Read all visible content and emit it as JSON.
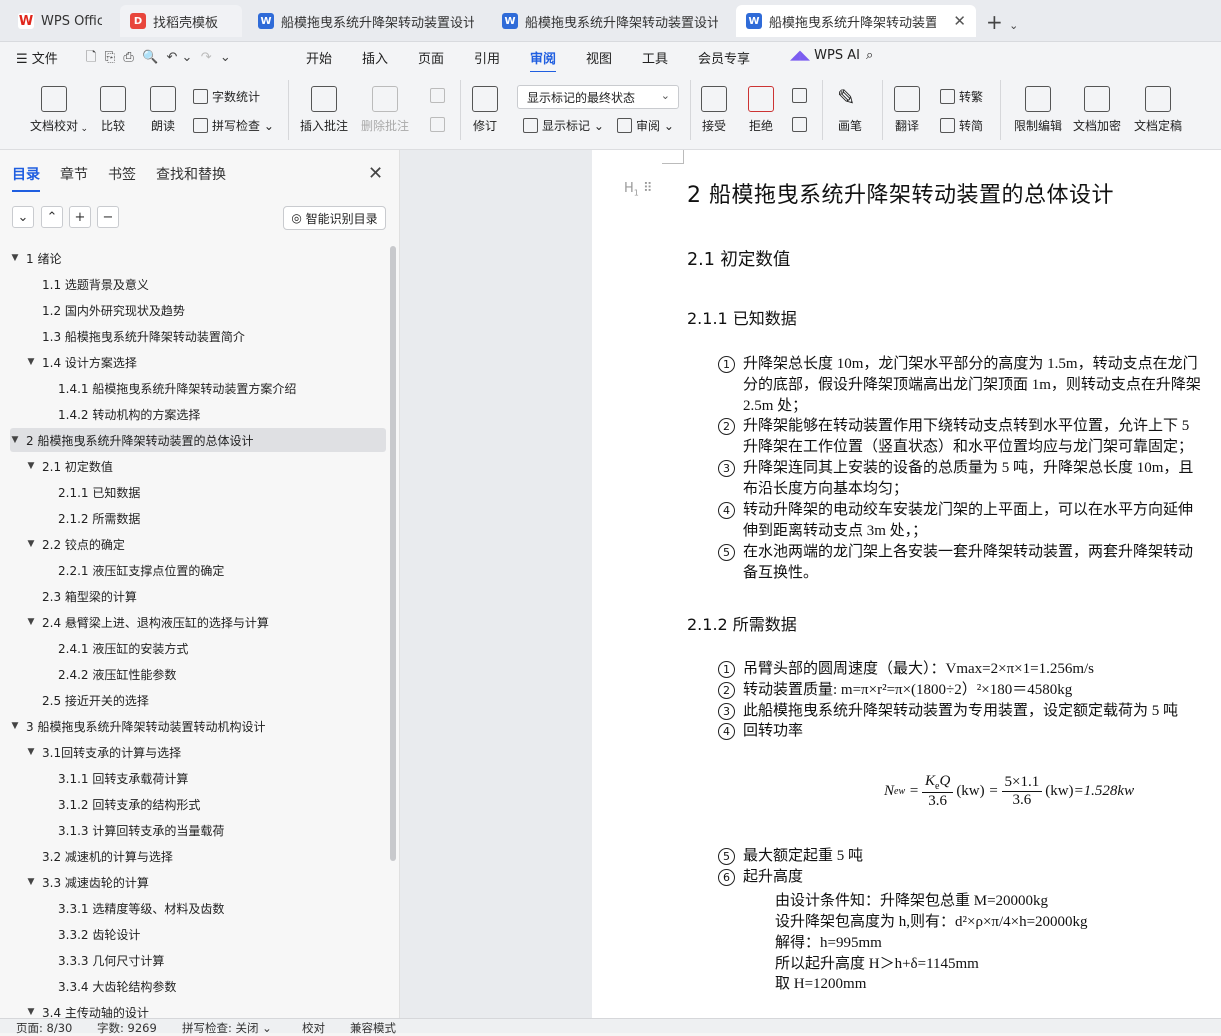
{
  "tabs": [
    {
      "label": "WPS Office",
      "icon": "wps-logo-icon"
    },
    {
      "label": "找稻壳模板",
      "icon": "docer-icon"
    },
    {
      "label": "船模拖曳系统升降架转动装置设计 任",
      "icon": "word-doc-icon"
    },
    {
      "label": "船模拖曳系统升降架转动装置设计 开",
      "icon": "word-doc-icon"
    },
    {
      "label": "船模拖曳系统升降架转动装置",
      "icon": "word-doc-icon"
    }
  ],
  "menu": {
    "file": "文件",
    "items": [
      "开始",
      "插入",
      "页面",
      "引用",
      "审阅",
      "视图",
      "工具",
      "会员专享"
    ],
    "active": "审阅",
    "wps_ai": "WPS AI"
  },
  "ribbon": {
    "doc_check": "文档校对",
    "compare": "比较",
    "read_aloud": "朗读",
    "word_count": "字数统计",
    "spell_check": "拼写检查",
    "insert_comment": "插入批注",
    "delete_comment": "删除批注",
    "revise": "修订",
    "markup_select": "显示标记的最终状态",
    "show_markup": "显示标记",
    "review": "审阅",
    "accept": "接受",
    "reject": "拒绝",
    "pen": "画笔",
    "translate": "翻译",
    "to_traditional": "转繁",
    "to_simplified": "转简",
    "restrict_edit": "限制编辑",
    "encrypt": "文档加密",
    "finalize": "文档定稿"
  },
  "sidebar": {
    "tabs": [
      "目录",
      "章节",
      "书签",
      "查找和替换"
    ],
    "smart_toc": "智能识别目录",
    "toc": [
      {
        "label": "1 绪论",
        "level": 0,
        "caret": true
      },
      {
        "label": "1.1 选题背景及意义",
        "level": 1
      },
      {
        "label": "1.2 国内外研究现状及趋势",
        "level": 1
      },
      {
        "label": "1.3 船模拖曳系统升降架转动装置简介",
        "level": 1
      },
      {
        "label": "1.4  设计方案选择",
        "level": 1,
        "caret": true
      },
      {
        "label": "1.4.1  船模拖曳系统升降架转动装置方案介绍",
        "level": 2
      },
      {
        "label": "1.4.2    转动机构的方案选择",
        "level": 2
      },
      {
        "label": "2    船模拖曳系统升降架转动装置的总体设计",
        "level": 0,
        "caret": true,
        "selected": true
      },
      {
        "label": "2.1    初定数值",
        "level": 1,
        "caret": true
      },
      {
        "label": "2.1.1 已知数据",
        "level": 2
      },
      {
        "label": "2.1.2 所需数据",
        "level": 2
      },
      {
        "label": "2.2    铰点的确定",
        "level": 1,
        "caret": true
      },
      {
        "label": "2.2.1    液压缸支撑点位置的确定",
        "level": 2
      },
      {
        "label": "2.3    箱型梁的计算",
        "level": 1
      },
      {
        "label": "2.4    悬臂梁上进、退构液压缸的选择与计算",
        "level": 1,
        "caret": true
      },
      {
        "label": "2.4.1    液压缸的安装方式",
        "level": 2
      },
      {
        "label": "2.4.2    液压缸性能参数",
        "level": 2
      },
      {
        "label": "2.5    接近开关的选择",
        "level": 1
      },
      {
        "label": "3    船模拖曳系统升降架转动装置转动机构设计",
        "level": 0,
        "caret": true
      },
      {
        "label": "3.1回转支承的计算与选择",
        "level": 1,
        "caret": true
      },
      {
        "label": "3.1.1    回转支承载荷计算",
        "level": 2
      },
      {
        "label": "3.1.2    回转支承的结构形式",
        "level": 2
      },
      {
        "label": "3.1.3    计算回转支承的当量载荷",
        "level": 2
      },
      {
        "label": "3.2    减速机的计算与选择",
        "level": 1
      },
      {
        "label": "3.3    减速齿轮的计算",
        "level": 1,
        "caret": true
      },
      {
        "label": "3.3.1    选精度等级、材料及齿数",
        "level": 2
      },
      {
        "label": "3.3.2    齿轮设计",
        "level": 2
      },
      {
        "label": "3.3.3    几何尺寸计算",
        "level": 2
      },
      {
        "label": "3.3.4    大齿轮结构参数",
        "level": 2
      },
      {
        "label": "3.4    主传动轴的设计",
        "level": 1,
        "caret": true
      }
    ]
  },
  "doc": {
    "heading_marker": "H",
    "h1": "2    船模拖曳系统升降架转动装置的总体设计",
    "h2": "2.1    初定数值",
    "h3a": "2.1.1 已知数据",
    "known": [
      {
        "n": "1",
        "l1": "升降架总长度 10m，龙门架水平部分的高度为 1.5m，转动支点在龙门",
        "l2": "分的底部，假设升降架顶端高出龙门架顶面 1m，则转动支点在升降架"
      },
      {
        "n": "",
        "l1": "2.5m 处；",
        "l2": ""
      },
      {
        "n": "2",
        "l1": "升降架能够在转动装置作用下绕转动支点转到水平位置，允许上下 5",
        "l2": "升降架在工作位置（竖直状态）和水平位置均应与龙门架可靠固定；"
      },
      {
        "n": "3",
        "l1": "升降架连同其上安装的设备的总质量为 5 吨，升降架总长度 10m，且",
        "l2": "布沿长度方向基本均匀；"
      },
      {
        "n": "4",
        "l1": "转动升降架的电动绞车安装龙门架的上平面上，可以在水平方向延伸",
        "l2": "伸到距离转动支点 3m 处，；"
      },
      {
        "n": "5",
        "l1": "在水池两端的龙门架上各安装一套升降架转动装置，两套升降架转动",
        "l2": "备互换性。"
      }
    ],
    "h3b": "2.1.2 所需数据",
    "needed": [
      {
        "n": "1",
        "t": "吊臂头部的圆周速度（最大）：Vmax=2×π×1=1.256m/s"
      },
      {
        "n": "2",
        "t": "转动装置质量: m=π×r²=π×(1800÷2）²×180＝4580kg"
      },
      {
        "n": "3",
        "t": "此船模拖曳系统升降架转动装置为专用装置，设定额定载荷为 5 吨"
      },
      {
        "n": "4",
        "t": "回转功率"
      }
    ],
    "formula": {
      "lhs": "N",
      "lhs_sub": "ew",
      "num1": "K",
      "num1_sub": "e",
      "num1_tail": "Q",
      "den1": "3.6",
      "unit": "(kw)",
      "num2": "5×1.1",
      "den2": "3.6",
      "result": "=1.528kw"
    },
    "more": [
      {
        "n": "5",
        "t": "最大额定起重  5 吨"
      },
      {
        "n": "6",
        "t": "起升高度"
      }
    ],
    "sub_lines": [
      "由设计条件知：升降架包总重 M=20000kg",
      "设升降架包高度为 h,则有：d²×ρ×π/4×h=20000kg",
      "解得：h=995mm",
      "所以起升高度  H＞h+δ=1145mm",
      "取 H=1200mm"
    ]
  },
  "status": {
    "page": "页面: 8/30",
    "words": "字数: 9269",
    "spell": "拼写检查: 关闭",
    "proof": "校对",
    "compat": "兼容模式"
  }
}
